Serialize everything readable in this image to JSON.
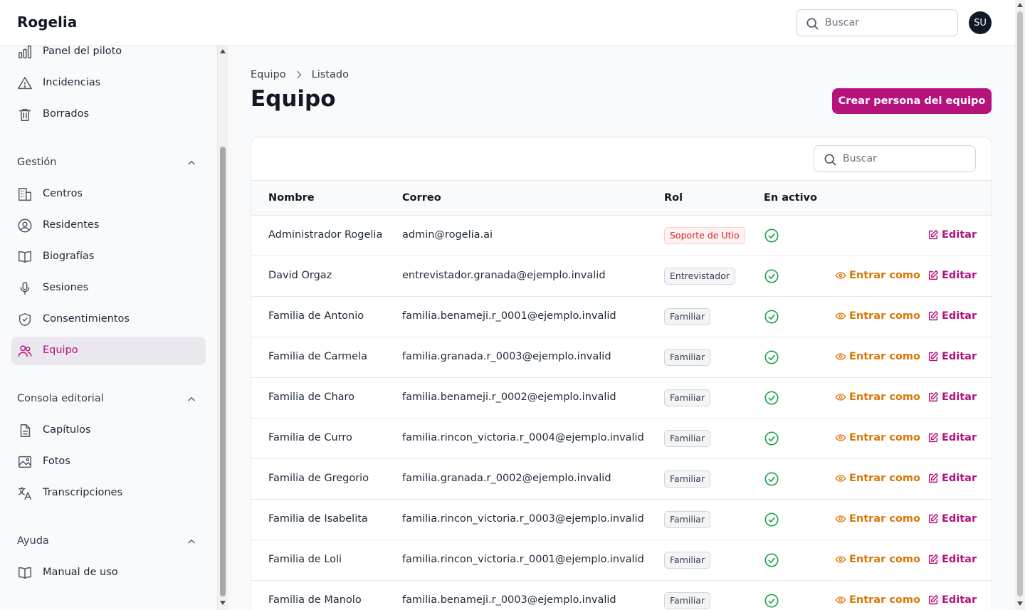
{
  "app": {
    "brand": "Rogelia",
    "avatar_initials": "SU"
  },
  "topbar": {
    "search_placeholder": "Buscar"
  },
  "sidebar": {
    "items_top": [
      {
        "label": "Panel del piloto",
        "icon": "bar-chart-icon"
      },
      {
        "label": "Incidencias",
        "icon": "warning-icon"
      },
      {
        "label": "Borrados",
        "icon": "trash-icon"
      }
    ],
    "sections": [
      {
        "title": "Gestión",
        "items": [
          {
            "label": "Centros",
            "icon": "building-icon"
          },
          {
            "label": "Residentes",
            "icon": "user-circle-icon"
          },
          {
            "label": "Biografías",
            "icon": "book-icon"
          },
          {
            "label": "Sesiones",
            "icon": "microphone-icon"
          },
          {
            "label": "Consentimientos",
            "icon": "shield-check-icon"
          },
          {
            "label": "Equipo",
            "icon": "users-icon",
            "active": true
          }
        ]
      },
      {
        "title": "Consola editorial",
        "items": [
          {
            "label": "Capítulos",
            "icon": "document-icon"
          },
          {
            "label": "Fotos",
            "icon": "photo-icon"
          },
          {
            "label": "Transcripciones",
            "icon": "language-icon"
          }
        ]
      },
      {
        "title": "Ayuda",
        "items": [
          {
            "label": "Manual de uso",
            "icon": "book-icon"
          }
        ]
      }
    ]
  },
  "main": {
    "breadcrumb": [
      "Equipo",
      "Listado"
    ],
    "title": "Equipo",
    "create_button": "Crear persona del equipo",
    "table_search_placeholder": "Buscar",
    "columns": [
      "Nombre",
      "Correo",
      "Rol",
      "En activo"
    ],
    "actions": {
      "enter_as": "Entrar como",
      "edit": "Editar"
    },
    "rows": [
      {
        "name": "Administrador Rogelia",
        "email": "admin@rogelia.ai",
        "role": "Soporte de Utio",
        "role_style": "red",
        "active": true,
        "can_enter": false
      },
      {
        "name": "David Orgaz",
        "email": "entrevistador.granada@ejemplo.invalid",
        "role": "Entrevistador",
        "role_style": "gray",
        "active": true,
        "can_enter": true
      },
      {
        "name": "Familia de Antonio",
        "email": "familia.benameji.r_0001@ejemplo.invalid",
        "role": "Familiar",
        "role_style": "default",
        "active": true,
        "can_enter": true
      },
      {
        "name": "Familia de Carmela",
        "email": "familia.granada.r_0003@ejemplo.invalid",
        "role": "Familiar",
        "role_style": "default",
        "active": true,
        "can_enter": true
      },
      {
        "name": "Familia de Charo",
        "email": "familia.benameji.r_0002@ejemplo.invalid",
        "role": "Familiar",
        "role_style": "default",
        "active": true,
        "can_enter": true
      },
      {
        "name": "Familia de Curro",
        "email": "familia.rincon_victoria.r_0004@ejemplo.invalid",
        "role": "Familiar",
        "role_style": "default",
        "active": true,
        "can_enter": true
      },
      {
        "name": "Familia de Gregorio",
        "email": "familia.granada.r_0002@ejemplo.invalid",
        "role": "Familiar",
        "role_style": "default",
        "active": true,
        "can_enter": true
      },
      {
        "name": "Familia de Isabelita",
        "email": "familia.rincon_victoria.r_0003@ejemplo.invalid",
        "role": "Familiar",
        "role_style": "default",
        "active": true,
        "can_enter": true
      },
      {
        "name": "Familia de Loli",
        "email": "familia.rincon_victoria.r_0001@ejemplo.invalid",
        "role": "Familiar",
        "role_style": "default",
        "active": true,
        "can_enter": true
      },
      {
        "name": "Familia de Manolo",
        "email": "familia.benameji.r_0003@ejemplo.invalid",
        "role": "Familiar",
        "role_style": "default",
        "active": true,
        "can_enter": true
      }
    ]
  },
  "colors": {
    "accent": "#b5127c",
    "warning": "#d97706",
    "success": "#16a34a",
    "danger": "#dc2626"
  }
}
